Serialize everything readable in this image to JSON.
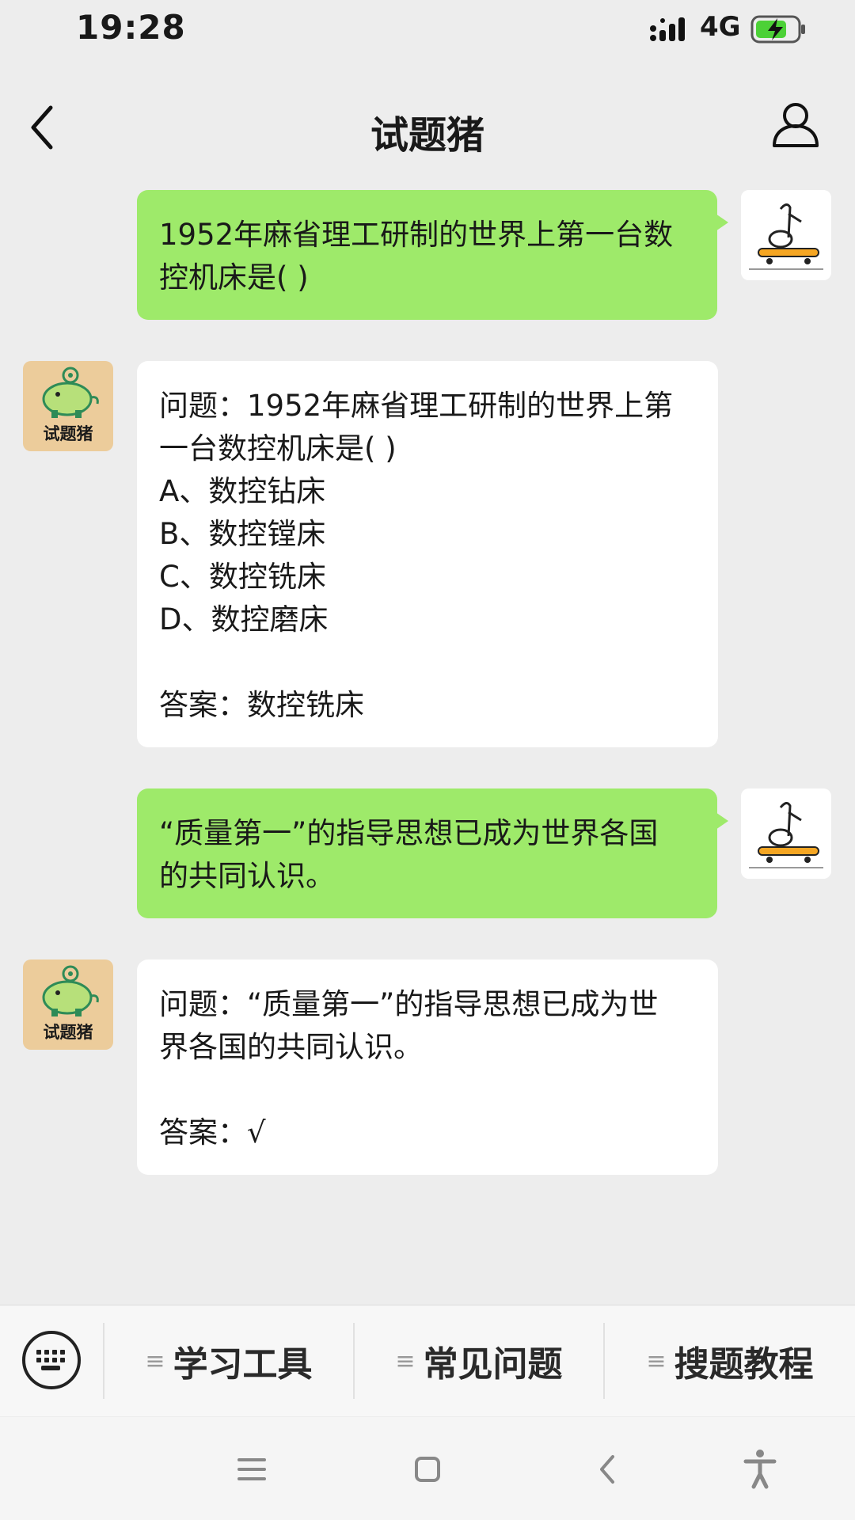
{
  "status": {
    "time": "19:28",
    "network": "4G"
  },
  "nav": {
    "title": "试题猪"
  },
  "bot_name": "试题猪",
  "messages": [
    {
      "side": "sent",
      "lines": [
        "1952年麻省理工研制的世界上第一台数",
        "控机床是( )"
      ]
    },
    {
      "side": "recv",
      "lines": [
        "问题：1952年麻省理工研制的世界上第",
        "一台数控机床是( )",
        "A、数控钻床",
        "B、数控镗床",
        "C、数控铣床",
        "D、数控磨床",
        "",
        "答案：数控铣床"
      ]
    },
    {
      "side": "sent",
      "lines": [
        "“质量第一”的指导思想已成为世界各国",
        "的共同认识。"
      ]
    },
    {
      "side": "recv",
      "lines": [
        "问题：“质量第一”的指导思想已成为世",
        "界各国的共同认识。",
        "",
        "答案：√"
      ]
    }
  ],
  "menu": {
    "items": [
      {
        "label": "学习工具",
        "icon": "menu-lines-icon"
      },
      {
        "label": "常见问题",
        "icon": "menu-lines-icon"
      },
      {
        "label": "搜题教程",
        "icon": "menu-lines-icon"
      }
    ]
  },
  "colors": {
    "sent_bubble": "#9eea6a",
    "recv_bubble": "#ffffff",
    "background": "#ededed",
    "bot_avatar": "#eccc9b"
  }
}
